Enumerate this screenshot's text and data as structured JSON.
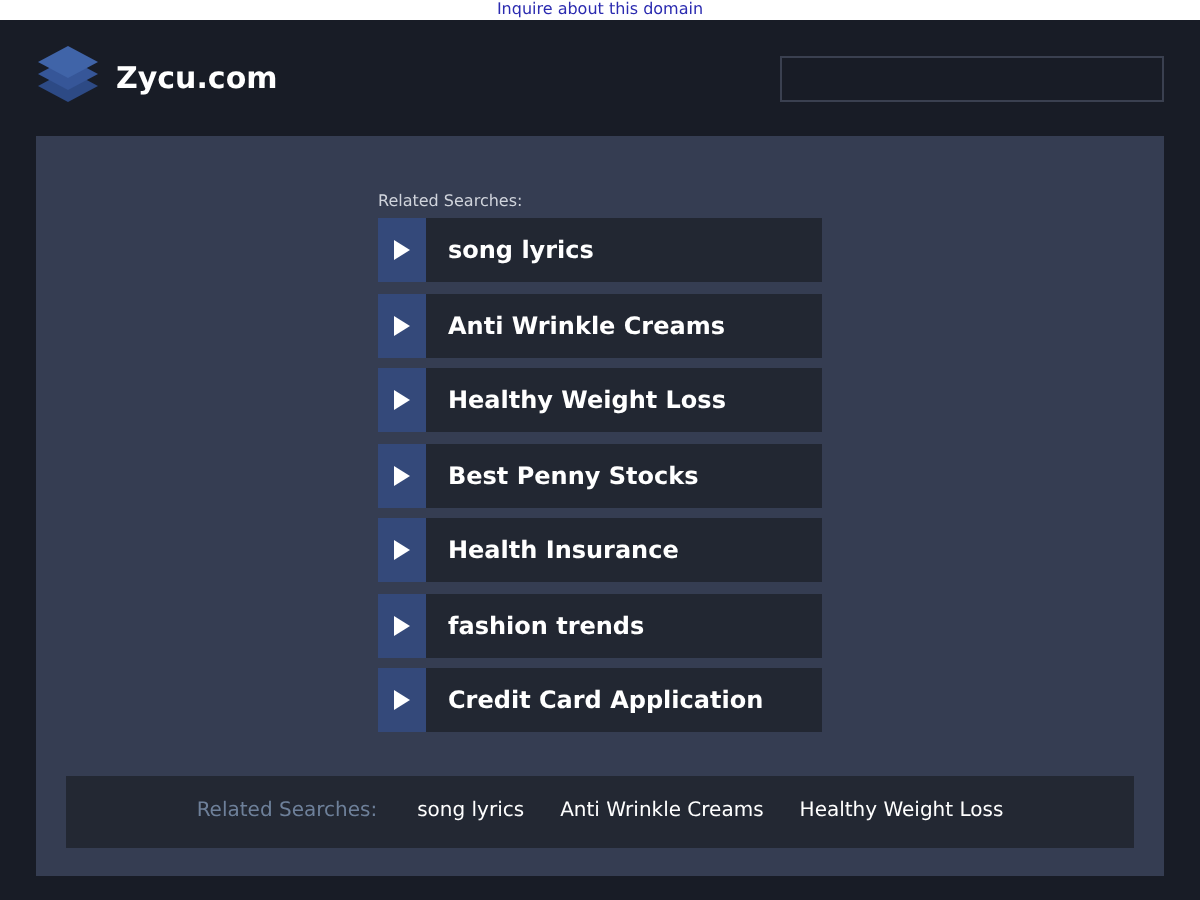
{
  "top_link": "Inquire about this domain",
  "header": {
    "site_name": "Zycu.com"
  },
  "related": {
    "title": "Related Searches:",
    "links": [
      "song lyrics",
      "Anti Wrinkle Creams",
      "Healthy Weight Loss",
      "Best Penny Stocks",
      "Health Insurance",
      "fashion trends",
      "Credit Card Application"
    ]
  },
  "footer": {
    "title": "Related Searches:",
    "links": [
      "song lyrics",
      "Anti Wrinkle Creams",
      "Healthy Weight Loss"
    ]
  }
}
